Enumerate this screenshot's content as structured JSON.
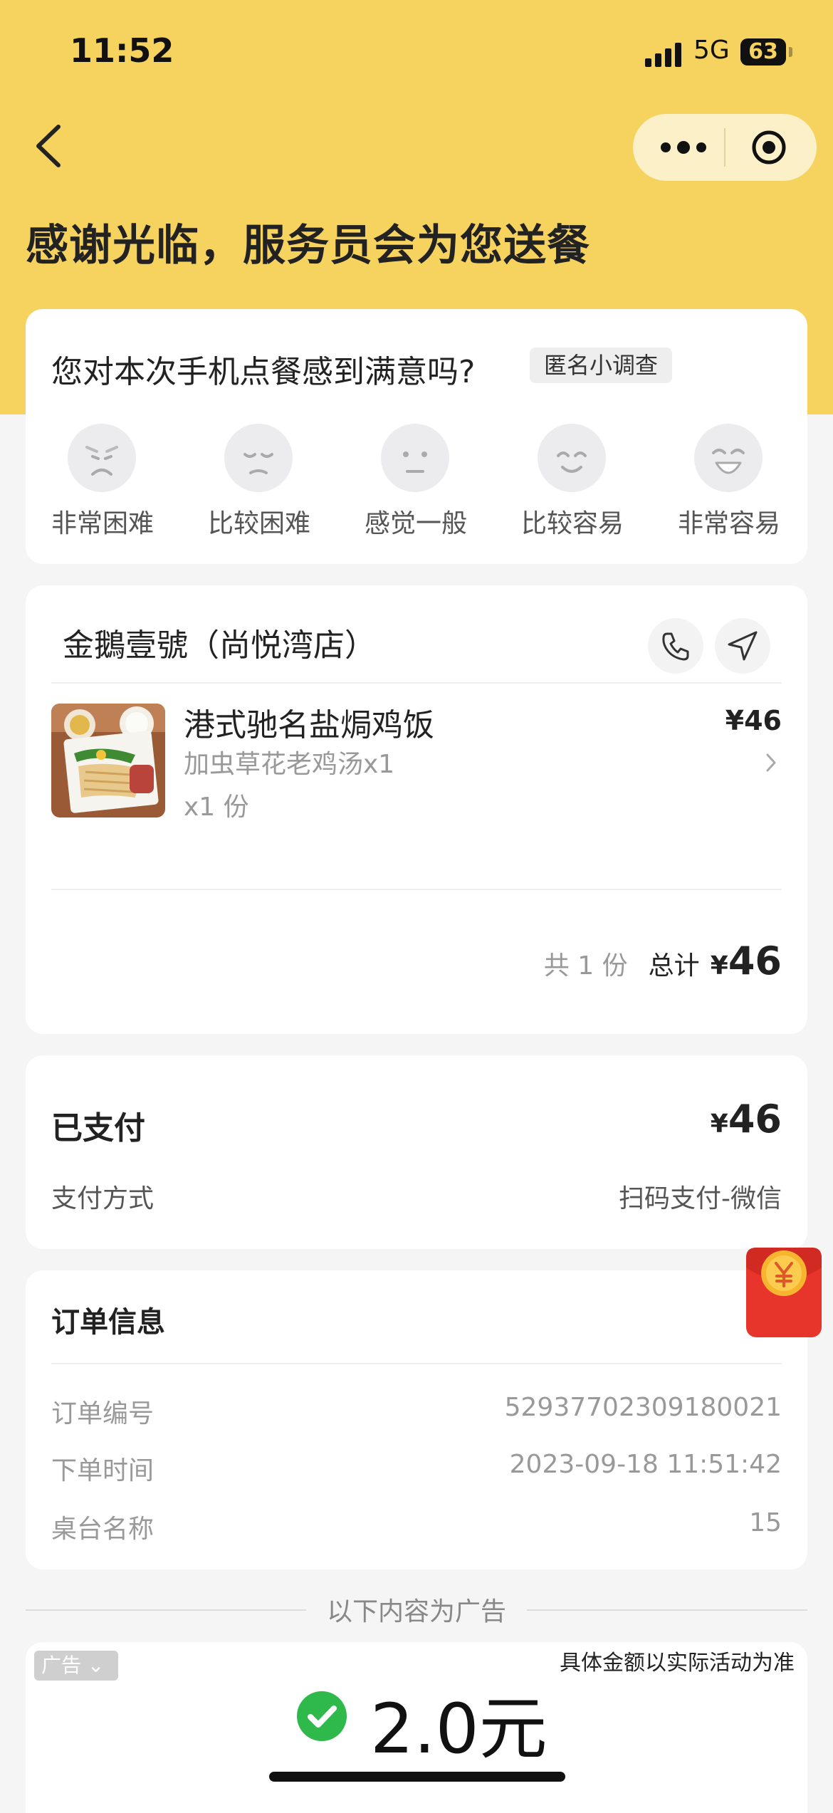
{
  "status_bar": {
    "time": "11:52",
    "network": "5G",
    "battery": "63"
  },
  "nav": {
    "back_icon": "chevron-left-icon",
    "more_icon": "more-dots-icon",
    "target_icon": "target-icon"
  },
  "header": {
    "title": "感谢光临，服务员会为您送餐"
  },
  "survey": {
    "question": "您对本次手机点餐感到满意吗?",
    "tag": "匿名小调查",
    "options": [
      {
        "label": "非常困难",
        "icon": "frown-face-icon"
      },
      {
        "label": "比较困难",
        "icon": "sad-face-icon"
      },
      {
        "label": "感觉一般",
        "icon": "neutral-face-icon"
      },
      {
        "label": "比较容易",
        "icon": "smile-face-icon"
      },
      {
        "label": "非常容易",
        "icon": "laugh-face-icon"
      }
    ]
  },
  "order": {
    "store_name": "金鵝壹號（尚悦湾店）",
    "phone_icon": "phone-icon",
    "nav_icon": "navigation-icon",
    "items": [
      {
        "name": "港式驰名盐焗鸡饭",
        "option": "加虫草花老鸡汤x1",
        "qty": "x1 份",
        "price": "¥46"
      }
    ],
    "count": "共 1 份",
    "total_label": "总计",
    "total_currency": "¥",
    "total_amount": "46"
  },
  "payment": {
    "paid_label": "已支付",
    "currency": "¥",
    "amount": "46",
    "method_label": "支付方式",
    "method_value": "扫码支付-微信"
  },
  "order_info": {
    "title": "订单信息",
    "rows": [
      {
        "label": "订单编号",
        "value": "52937702309180021"
      },
      {
        "label": "下单时间",
        "value": "2023-09-18 11:51:42"
      },
      {
        "label": "桌台名称",
        "value": "15"
      }
    ]
  },
  "ad": {
    "divider": "以下内容为广告",
    "tag": "广告",
    "note": "具体金额以实际活动为准",
    "amount": "2.0元"
  },
  "colors": {
    "header_bg": "#f6d25f",
    "check_green": "#2fb94a",
    "redpack": "#e8352b"
  }
}
